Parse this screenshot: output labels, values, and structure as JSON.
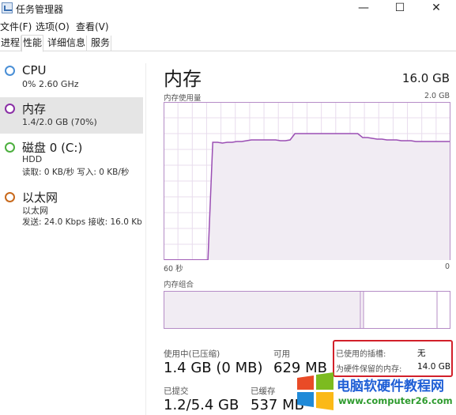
{
  "window": {
    "title": "任务管理器",
    "minimize": "—",
    "maximize": "☐",
    "close": "✕"
  },
  "menu": [
    "文件(F)",
    "选项(O)",
    "查看(V)"
  ],
  "tabs": [
    "进程",
    "性能",
    "详细信息",
    "服务"
  ],
  "sidebar": {
    "items": [
      {
        "title": "CPU",
        "sub": "0% 2.60 GHz",
        "color": "#4a8fd6"
      },
      {
        "title": "内存",
        "sub": "1.4/2.0 GB (70%)",
        "color": "#8b2fa6"
      },
      {
        "title": "磁盘 0 (C:)",
        "sub": "HDD",
        "sub2": "读取: 0 KB/秒 写入: 0 KB/秒",
        "color": "#4caf3e"
      },
      {
        "title": "以太网",
        "sub": "以太网",
        "sub2": "发送: 24.0 Kbps 接收: 16.0 Kb",
        "color": "#c8691c"
      }
    ]
  },
  "main": {
    "title": "内存",
    "total": "16.0 GB",
    "graph_label": "内存使用量",
    "graph_max": "2.0 GB",
    "time_left": "60 秒",
    "time_right": "0",
    "composition_label": "内存组合",
    "usage_series": [
      0,
      0,
      0,
      0,
      0,
      0,
      0,
      0,
      0,
      0,
      1.49,
      1.49,
      1.48,
      1.49,
      1.49,
      1.5,
      1.5,
      1.51,
      1.52,
      1.52,
      1.52,
      1.52,
      1.52,
      1.52,
      1.51,
      1.51,
      1.52,
      1.6,
      1.6,
      1.6,
      1.6,
      1.6,
      1.6,
      1.6,
      1.6,
      1.6,
      1.6,
      1.6,
      1.6,
      1.6,
      1.6,
      1.55,
      1.55,
      1.54,
      1.53,
      1.53,
      1.52,
      1.52,
      1.52,
      1.51,
      1.51,
      1.51,
      1.5,
      1.5,
      1.5,
      1.5,
      1.5,
      1.5,
      1.5,
      1.5
    ],
    "stats": {
      "in_use_label": "使用中(已压缩)",
      "in_use_value": "1.4 GB (0 MB)",
      "available_label": "可用",
      "available_value": "629 MB",
      "committed_label": "已提交",
      "committed_value": "1.2/5.4 GB",
      "cached_label": "已缓存",
      "cached_value": "537 MB",
      "slots_label": "已使用的插槽:",
      "slots_value": "无",
      "reserved_label": "为硬件保留的内存:",
      "reserved_value": "14.0 GB"
    }
  },
  "watermark": {
    "title": "电脑软硬件教程网",
    "url": "www.computer26.com"
  },
  "colors": {
    "accent": "#8b2fa6",
    "graph_fill": "#f1ecf3",
    "grid": "#e8dced",
    "highlight": "#d2202a"
  }
}
